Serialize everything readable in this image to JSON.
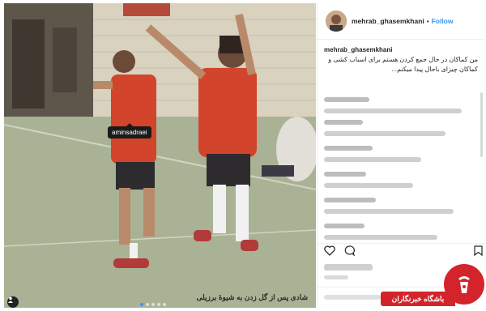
{
  "post": {
    "username": "mehrab_ghasemkhani",
    "separator": "•",
    "follow_label": "Follow",
    "caption_user": "mehrab_ghasemkhani",
    "caption_text": "من کماکان در حال جمع کردن هستم برای اسباب کشی و کماکان چیزای باحال پیدا میکنم...",
    "photo_tag": "aminsadraei",
    "photo_caption": "شادی پس از گل زدن به شیوهٔ برزیلی",
    "carousel_pages": 5,
    "carousel_active": 1
  },
  "watermark": {
    "label": "باشگاه خبرنگاران"
  },
  "icons": {
    "heart": "heart-icon",
    "comment": "comment-icon",
    "bookmark": "bookmark-icon",
    "user_tag": "user-tag-icon"
  },
  "colors": {
    "follow": "#3897f0",
    "jersey": "#d2442c",
    "watermark": "#d4242b"
  }
}
